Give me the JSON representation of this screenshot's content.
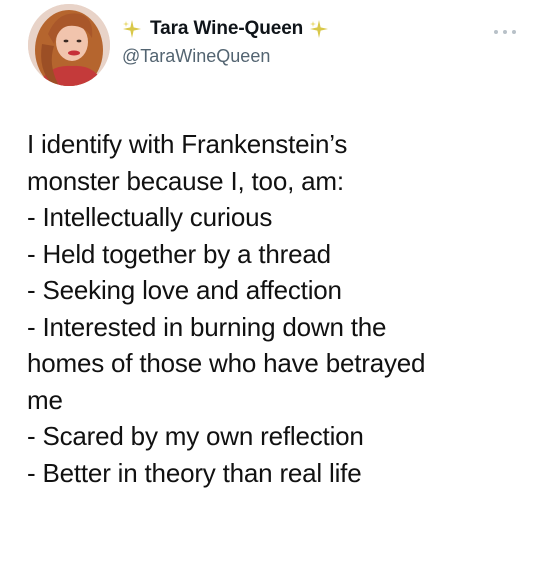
{
  "tweet": {
    "author": {
      "display_name": "Tara Wine-Queen",
      "handle": "@TaraWineQueen",
      "avatar_icon": "profile-photo",
      "badge_icon": "sparkles-emoji",
      "badge_color": "#d4c44a"
    },
    "more_icon": "ellipsis-icon",
    "text": {
      "intro_line_1": "I identify with Frankenstein’s",
      "intro_line_2": "monster because I, too, am:",
      "items": [
        "- Intellectually curious",
        "- Held together by a thread",
        "- Seeking love and affection",
        "- Interested in burning down the",
        "homes of those who have betrayed",
        "me",
        "- Scared by my own reflection",
        "- Better in theory than real life"
      ]
    }
  }
}
